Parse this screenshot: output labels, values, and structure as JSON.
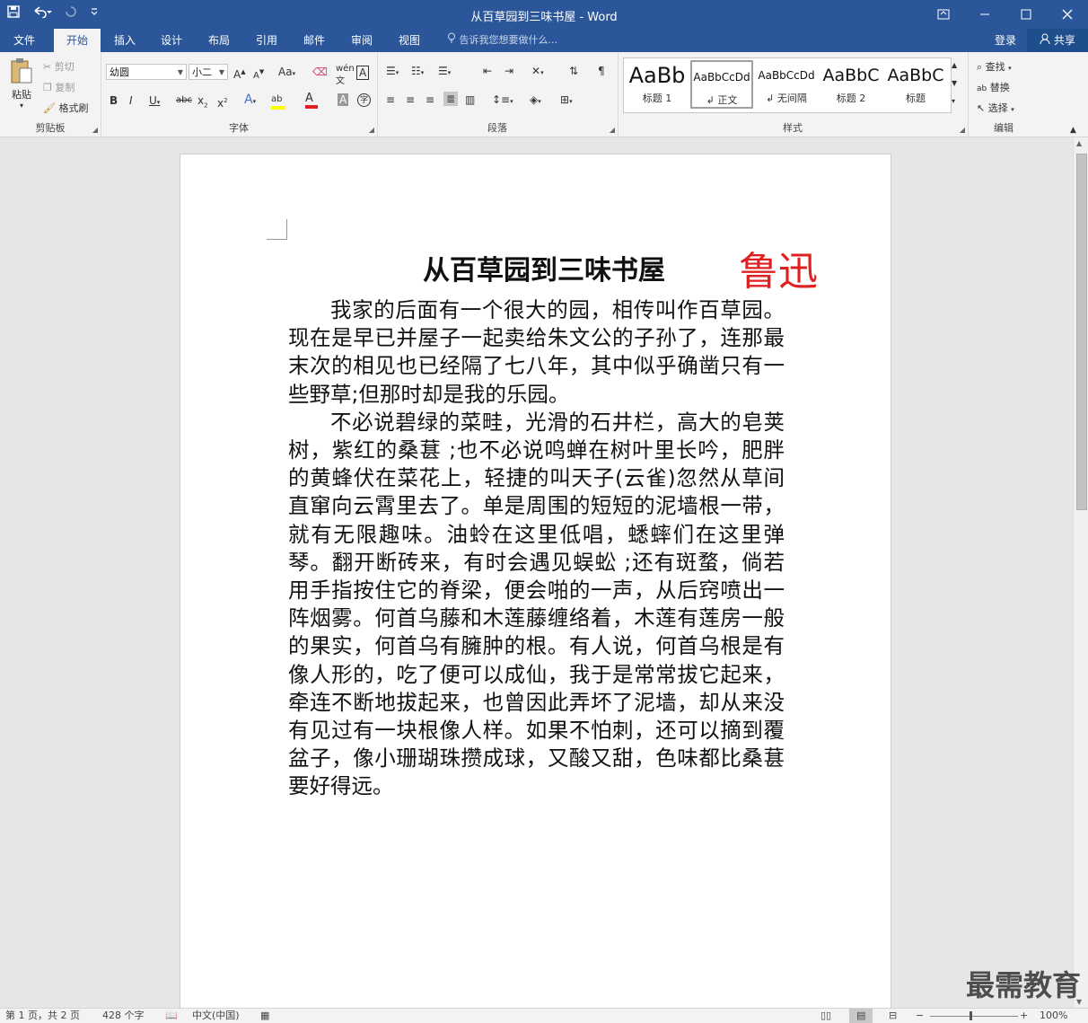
{
  "window": {
    "title": "从百草园到三味书屋 - Word"
  },
  "qat": {
    "save_icon": "save-icon",
    "undo_icon": "undo-icon",
    "redo_icon": "redo-icon",
    "customize_icon": "customize-icon"
  },
  "tabs": [
    {
      "label": "文件"
    },
    {
      "label": "开始"
    },
    {
      "label": "插入"
    },
    {
      "label": "设计"
    },
    {
      "label": "布局"
    },
    {
      "label": "引用"
    },
    {
      "label": "邮件"
    },
    {
      "label": "审阅"
    },
    {
      "label": "视图"
    }
  ],
  "tellme": {
    "text": "告诉我您想要做什么..."
  },
  "account": {
    "login": "登录",
    "share": "共享"
  },
  "clipboard": {
    "paste": "粘贴",
    "cut": "剪切",
    "copy": "复制",
    "format_painter": "格式刷",
    "label": "剪贴板"
  },
  "font": {
    "name": "幼圆",
    "size": "小二",
    "label": "字体"
  },
  "paragraph": {
    "label": "段落"
  },
  "styles": {
    "label": "样式",
    "items": [
      {
        "preview": "AaBb",
        "name": "标题 1"
      },
      {
        "preview": "AaBbCcDd",
        "name": "↲ 正文"
      },
      {
        "preview": "AaBbCcDd",
        "name": "↲ 无间隔"
      },
      {
        "preview": "AaBbC",
        "name": "标题 2"
      },
      {
        "preview": "AaBbC",
        "name": "标题"
      }
    ]
  },
  "editing": {
    "find": "查找",
    "replace": "替换",
    "select": "选择",
    "label": "编辑"
  },
  "document": {
    "title": "从百草园到三味书屋",
    "author": "鲁迅",
    "paragraphs": [
      "我家的后面有一个很大的园，相传叫作百草园。现在是早已并屋子一起卖给朱文公的子孙了，连那最末次的相见也已经隔了七八年，其中似乎确凿只有一些野草;但那时却是我的乐园。",
      "不必说碧绿的菜畦，光滑的石井栏，高大的皂荚树，紫红的桑葚 ;也不必说鸣蝉在树叶里长吟，肥胖的黄蜂伏在菜花上，轻捷的叫天子(云雀)忽然从草间直窜向云霄里去了。单是周围的短短的泥墙根一带，就有无限趣味。油蛉在这里低唱，蟋蟀们在这里弹琴。翻开断砖来，有时会遇见蜈蚣 ;还有斑蝥，倘若用手指按住它的脊梁，便会啪的一声，从后窍喷出一阵烟雾。何首乌藤和木莲藤缠络着，木莲有莲房一般的果实，何首乌有臃肿的根。有人说，何首乌根是有像人形的，吃了便可以成仙，我于是常常拔它起来，牵连不断地拔起来，也曾因此弄坏了泥墙，却从来没有见过有一块根像人样。如果不怕刺，还可以摘到覆盆子，像小珊瑚珠攒成球，又酸又甜，色味都比桑葚要好得远。"
    ]
  },
  "status": {
    "page": "第 1 页，共 2 页",
    "words": "428 个字",
    "lang": "中文(中国)",
    "zoom": "100%"
  },
  "watermark": "最需教育",
  "colors": {
    "brand": "#2b579a",
    "author": "#e02020"
  }
}
